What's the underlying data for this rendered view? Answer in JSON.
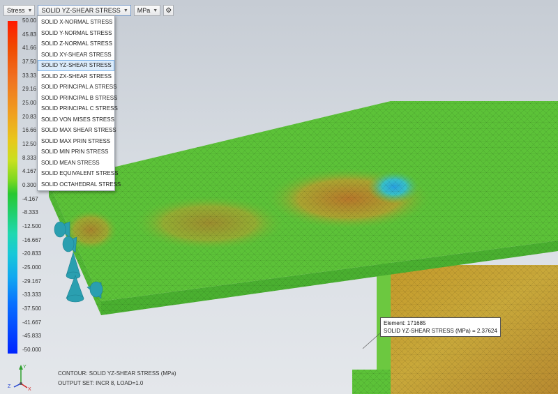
{
  "toolbar": {
    "result_type": "Stress",
    "component": "SOLID YZ-SHEAR STRESS",
    "units": "MPa",
    "settings_icon": "gear-icon"
  },
  "dropdown": {
    "items": [
      "SOLID X-NORMAL STRESS",
      "SOLID Y-NORMAL STRESS",
      "SOLID Z-NORMAL STRESS",
      "SOLID XY-SHEAR STRESS",
      "SOLID YZ-SHEAR STRESS",
      "SOLID ZX-SHEAR STRESS",
      "SOLID PRINCIPAL A STRESS",
      "SOLID PRINCIPAL B STRESS",
      "SOLID PRINCIPAL C STRESS",
      "SOLID VON MISES STRESS",
      "SOLID MAX SHEAR STRESS",
      "SOLID MAX PRIN STRESS",
      "SOLID MIN PRIN STRESS",
      "SOLID MEAN STRESS",
      "SOLID EQUIVALENT STRESS",
      "SOLID OCTAHEDRAL STRESS"
    ],
    "selected_index": 4
  },
  "legend": {
    "ticks": [
      "50.00",
      "45.83",
      "41.66",
      "37.50",
      "33.33",
      "29.16",
      "25.00",
      "20.83",
      "16.66",
      "12.50",
      "8.333",
      "4.167",
      "0.300",
      "-4.167",
      "-8.333",
      "-12.500",
      "-16.667",
      "-20.833",
      "-25.000",
      "-29.167",
      "-33.333",
      "-37.500",
      "-41.667",
      "-45.833",
      "-50.000"
    ]
  },
  "contour_info": {
    "line1": "CONTOUR: SOLID YZ-SHEAR STRESS (MPa)",
    "line2": "OUTPUT SET: INCR 8, LOAD=1.0"
  },
  "probe": {
    "element_label": "Element: 171685",
    "value_label": "SOLID YZ-SHEAR STRESS (MPa)  = 2.37624"
  },
  "triad": {
    "y": "Y",
    "z": "Z",
    "x": "X"
  },
  "colors": {
    "mesh_green": "#5cc238",
    "mesh_orange": "#c88a30",
    "hotspot_cyan": "#38b8c8",
    "support_cyan": "#2a9fb0"
  }
}
